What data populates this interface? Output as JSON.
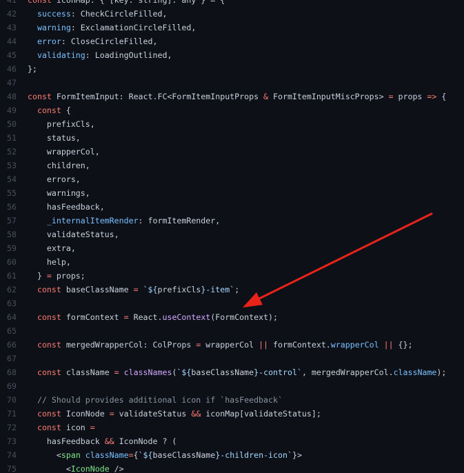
{
  "editor": {
    "theme_colors": {
      "background": "#0d1117",
      "text": "#c9d1d9",
      "line_number": "#484f58",
      "keyword": "#ff7b72",
      "entity": "#d2a8ff",
      "string": "#a5d6ff",
      "property": "#79c0ff",
      "comment": "#8b949e",
      "tag": "#7ee787",
      "annotation_arrow": "#e8231a"
    },
    "lines": [
      {
        "num": "41",
        "tokens": [
          [
            "kw",
            "const "
          ],
          [
            "plain",
            "iconMap: { [key: string]: any } = {"
          ]
        ]
      },
      {
        "num": "42",
        "tokens": [
          [
            "plain",
            "  "
          ],
          [
            "prop",
            "success"
          ],
          [
            "plain",
            ": CheckCircleFilled,"
          ]
        ]
      },
      {
        "num": "43",
        "tokens": [
          [
            "plain",
            "  "
          ],
          [
            "prop",
            "warning"
          ],
          [
            "plain",
            ": ExclamationCircleFilled,"
          ]
        ]
      },
      {
        "num": "44",
        "tokens": [
          [
            "plain",
            "  "
          ],
          [
            "prop",
            "error"
          ],
          [
            "plain",
            ": CloseCircleFilled,"
          ]
        ]
      },
      {
        "num": "45",
        "tokens": [
          [
            "plain",
            "  "
          ],
          [
            "prop",
            "validating"
          ],
          [
            "plain",
            ": LoadingOutlined,"
          ]
        ]
      },
      {
        "num": "46",
        "tokens": [
          [
            "plain",
            "};"
          ]
        ]
      },
      {
        "num": "47",
        "tokens": []
      },
      {
        "num": "48",
        "tokens": [
          [
            "kw",
            "const "
          ],
          [
            "plain",
            "FormItemInput: React.FC<FormItemInputProps "
          ],
          [
            "kw",
            "&"
          ],
          [
            "plain",
            " FormItemInputMiscProps> "
          ],
          [
            "kw",
            "="
          ],
          [
            "plain",
            " props "
          ],
          [
            "kw",
            "=>"
          ],
          [
            "plain",
            " {"
          ]
        ]
      },
      {
        "num": "49",
        "tokens": [
          [
            "plain",
            "  "
          ],
          [
            "kw",
            "const "
          ],
          [
            "plain",
            "{"
          ]
        ]
      },
      {
        "num": "50",
        "tokens": [
          [
            "plain",
            "    prefixCls,"
          ]
        ]
      },
      {
        "num": "51",
        "tokens": [
          [
            "plain",
            "    status,"
          ]
        ]
      },
      {
        "num": "52",
        "tokens": [
          [
            "plain",
            "    wrapperCol,"
          ]
        ]
      },
      {
        "num": "53",
        "tokens": [
          [
            "plain",
            "    children,"
          ]
        ]
      },
      {
        "num": "54",
        "tokens": [
          [
            "plain",
            "    errors,"
          ]
        ]
      },
      {
        "num": "55",
        "tokens": [
          [
            "plain",
            "    warnings,"
          ]
        ]
      },
      {
        "num": "56",
        "tokens": [
          [
            "plain",
            "    hasFeedback,"
          ]
        ]
      },
      {
        "num": "57",
        "tokens": [
          [
            "plain",
            "    "
          ],
          [
            "prop",
            "_internalItemRender"
          ],
          [
            "plain",
            ": formItemRender,"
          ]
        ]
      },
      {
        "num": "58",
        "tokens": [
          [
            "plain",
            "    validateStatus,"
          ]
        ]
      },
      {
        "num": "59",
        "tokens": [
          [
            "plain",
            "    extra,"
          ]
        ]
      },
      {
        "num": "60",
        "tokens": [
          [
            "plain",
            "    help,"
          ]
        ]
      },
      {
        "num": "61",
        "tokens": [
          [
            "plain",
            "  } "
          ],
          [
            "kw",
            "="
          ],
          [
            "plain",
            " props;"
          ]
        ]
      },
      {
        "num": "62",
        "tokens": [
          [
            "plain",
            "  "
          ],
          [
            "kw",
            "const "
          ],
          [
            "plain",
            "baseClassName "
          ],
          [
            "kw",
            "="
          ],
          [
            "plain",
            " "
          ],
          [
            "str",
            "`${"
          ],
          [
            "plain",
            "prefixCls"
          ],
          [
            "str",
            "}-item`"
          ],
          [
            "plain",
            ";"
          ]
        ]
      },
      {
        "num": "63",
        "tokens": []
      },
      {
        "num": "64",
        "tokens": [
          [
            "plain",
            "  "
          ],
          [
            "kw",
            "const "
          ],
          [
            "plain",
            "formContext "
          ],
          [
            "kw",
            "="
          ],
          [
            "plain",
            " React."
          ],
          [
            "ent",
            "useContext"
          ],
          [
            "plain",
            "(FormContext);"
          ]
        ]
      },
      {
        "num": "65",
        "tokens": []
      },
      {
        "num": "66",
        "tokens": [
          [
            "plain",
            "  "
          ],
          [
            "kw",
            "const "
          ],
          [
            "plain",
            "mergedWrapperCol: ColProps "
          ],
          [
            "kw",
            "="
          ],
          [
            "plain",
            " wrapperCol "
          ],
          [
            "kw",
            "||"
          ],
          [
            "plain",
            " formContext."
          ],
          [
            "prop",
            "wrapperCol"
          ],
          [
            "plain",
            " "
          ],
          [
            "kw",
            "||"
          ],
          [
            "plain",
            " {};"
          ]
        ]
      },
      {
        "num": "67",
        "tokens": []
      },
      {
        "num": "68",
        "tokens": [
          [
            "plain",
            "  "
          ],
          [
            "kw",
            "const "
          ],
          [
            "plain",
            "className "
          ],
          [
            "kw",
            "="
          ],
          [
            "plain",
            " "
          ],
          [
            "ent",
            "classNames"
          ],
          [
            "plain",
            "("
          ],
          [
            "str",
            "`${"
          ],
          [
            "plain",
            "baseClassName"
          ],
          [
            "str",
            "}-control`"
          ],
          [
            "plain",
            ", mergedWrapperCol."
          ],
          [
            "prop",
            "className"
          ],
          [
            "plain",
            ");"
          ]
        ]
      },
      {
        "num": "69",
        "tokens": []
      },
      {
        "num": "70",
        "tokens": [
          [
            "plain",
            "  "
          ],
          [
            "com",
            "// Should provides additional icon if `hasFeedback`"
          ]
        ]
      },
      {
        "num": "71",
        "tokens": [
          [
            "plain",
            "  "
          ],
          [
            "kw",
            "const "
          ],
          [
            "plain",
            "IconNode "
          ],
          [
            "kw",
            "="
          ],
          [
            "plain",
            " validateStatus "
          ],
          [
            "kw",
            "&&"
          ],
          [
            "plain",
            " iconMap[validateStatus];"
          ]
        ]
      },
      {
        "num": "72",
        "tokens": [
          [
            "plain",
            "  "
          ],
          [
            "kw",
            "const "
          ],
          [
            "plain",
            "icon "
          ],
          [
            "kw",
            "="
          ]
        ]
      },
      {
        "num": "73",
        "tokens": [
          [
            "plain",
            "    hasFeedback "
          ],
          [
            "kw",
            "&&"
          ],
          [
            "plain",
            " IconNode ? ("
          ]
        ]
      },
      {
        "num": "74",
        "tokens": [
          [
            "plain",
            "      <"
          ],
          [
            "tag",
            "span"
          ],
          [
            "plain",
            " "
          ],
          [
            "prop",
            "className"
          ],
          [
            "kw",
            "="
          ],
          [
            "plain",
            "{"
          ],
          [
            "str",
            "`${"
          ],
          [
            "plain",
            "baseClassName"
          ],
          [
            "str",
            "}-children-icon`"
          ],
          [
            "plain",
            "}>"
          ]
        ]
      },
      {
        "num": "75",
        "tokens": [
          [
            "plain",
            "        <"
          ],
          [
            "tag",
            "IconNode"
          ],
          [
            "plain",
            " />"
          ]
        ]
      }
    ]
  }
}
